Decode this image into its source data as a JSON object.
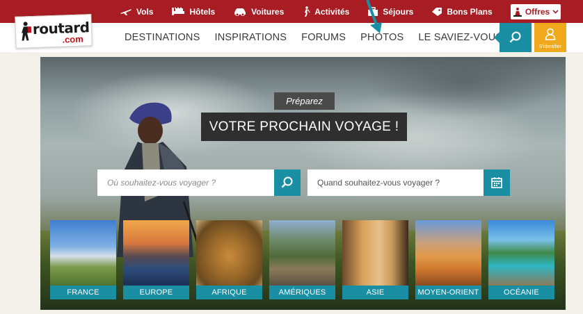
{
  "logo": {
    "main": "routard",
    "sub": ".com"
  },
  "topbar": {
    "links": [
      {
        "label": "Vols",
        "icon": "plane-icon"
      },
      {
        "label": "Hôtels",
        "icon": "bed-icon"
      },
      {
        "label": "Voitures",
        "icon": "car-icon"
      },
      {
        "label": "Activités",
        "icon": "hiker-icon"
      },
      {
        "label": "Séjours",
        "icon": "suitcase-icon"
      },
      {
        "label": "Bons Plans",
        "icon": "tag-icon"
      }
    ],
    "offres": "Offres"
  },
  "nav": {
    "items": [
      "DESTINATIONS",
      "INSPIRATIONS",
      "FORUMS",
      "PHOTOS",
      "LE SAVIEZ-VOUS ?"
    ],
    "login_label": "S'identifier"
  },
  "hero": {
    "kicker": "Préparez",
    "headline": "VOTRE PROCHAIN VOYAGE !",
    "where_placeholder": "Où souhaitez-vous voyager ?",
    "when_placeholder": "Quand souhaitez-vous voyager ?"
  },
  "destinations": [
    "FRANCE",
    "EUROPE",
    "AFRIQUE",
    "AMÉRIQUES",
    "ASIE",
    "MOYEN-ORIENT",
    "OCÉANIE"
  ],
  "colors": {
    "brand_red": "#a81d23",
    "teal": "#1a8ea3",
    "orange": "#f0a81d"
  }
}
